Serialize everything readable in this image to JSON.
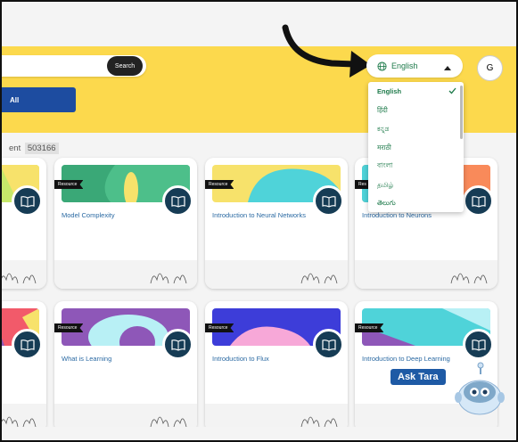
{
  "header": {
    "search_button": "Search",
    "all_button": "All",
    "profile_initial": "G",
    "language": {
      "selected": "English",
      "options": [
        "English",
        "हिंदी",
        "ಕನ್ನಡ",
        "मराठी",
        "বাংলা",
        "தமிழ்",
        "తెలుగు"
      ]
    }
  },
  "content": {
    "label": "ent",
    "count": "503166"
  },
  "cards": [
    {
      "tag": "",
      "title": ""
    },
    {
      "tag": "Resource",
      "title": "Model Complexity"
    },
    {
      "tag": "Resource",
      "title": "Introduction to Neural Networks"
    },
    {
      "tag": "Res",
      "title": "Introduction to Neurons"
    },
    {
      "tag": "",
      "title": ""
    },
    {
      "tag": "Resource",
      "title": "What is Learning"
    },
    {
      "tag": "Resource",
      "title": "Introduction to Flux"
    },
    {
      "tag": "Resource",
      "title": "Introduction to Deep Learning"
    }
  ],
  "assistant": {
    "label": "Ask Tara"
  },
  "colors": {
    "banner": "#fcd94d",
    "primary_button": "#1d4ca0",
    "language_text": "#1d7a4a",
    "card_title": "#2b6aa3"
  }
}
